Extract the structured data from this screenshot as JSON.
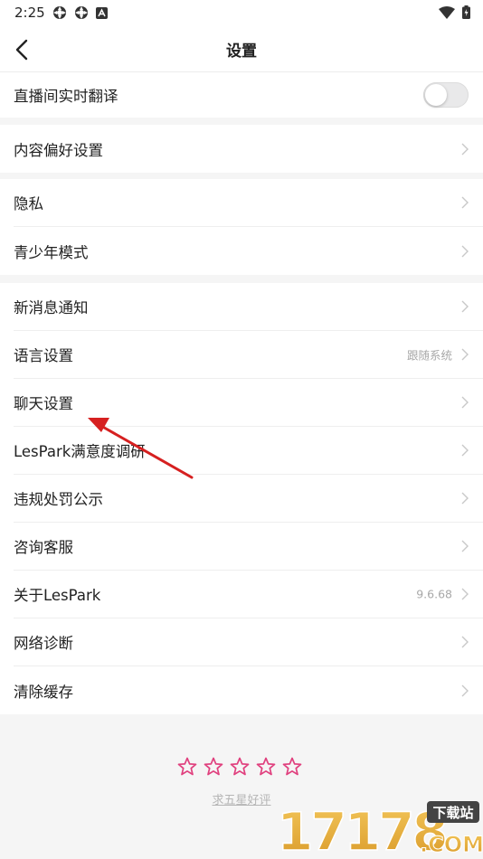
{
  "status_bar": {
    "time": "2:25"
  },
  "header": {
    "title": "设置"
  },
  "groups": [
    {
      "items": [
        {
          "label": "直播间实时翻译",
          "toggle_on": false
        }
      ]
    },
    {
      "items": [
        {
          "label": "内容偏好设置"
        }
      ]
    },
    {
      "items": [
        {
          "label": "隐私"
        },
        {
          "label": "青少年模式"
        }
      ]
    },
    {
      "items": [
        {
          "label": "新消息通知"
        },
        {
          "label": "语言设置",
          "value": "跟随系统"
        },
        {
          "label": "聊天设置"
        },
        {
          "label": "LesPark满意度调研"
        },
        {
          "label": "违规处罚公示"
        },
        {
          "label": "咨询客服"
        },
        {
          "label": "关于LesPark",
          "value": "9.6.68"
        },
        {
          "label": "网络诊断"
        },
        {
          "label": "清除缓存"
        }
      ]
    }
  ],
  "rating": {
    "star_count": 5,
    "link_text": "求五星好评"
  },
  "watermark": {
    "brand": "17178",
    "tag": "下载站",
    "domain": ".COM"
  },
  "colors": {
    "accent_star": "#e0407e",
    "annotation_arrow": "#d62020",
    "page_bg": "#f5f5f5"
  }
}
